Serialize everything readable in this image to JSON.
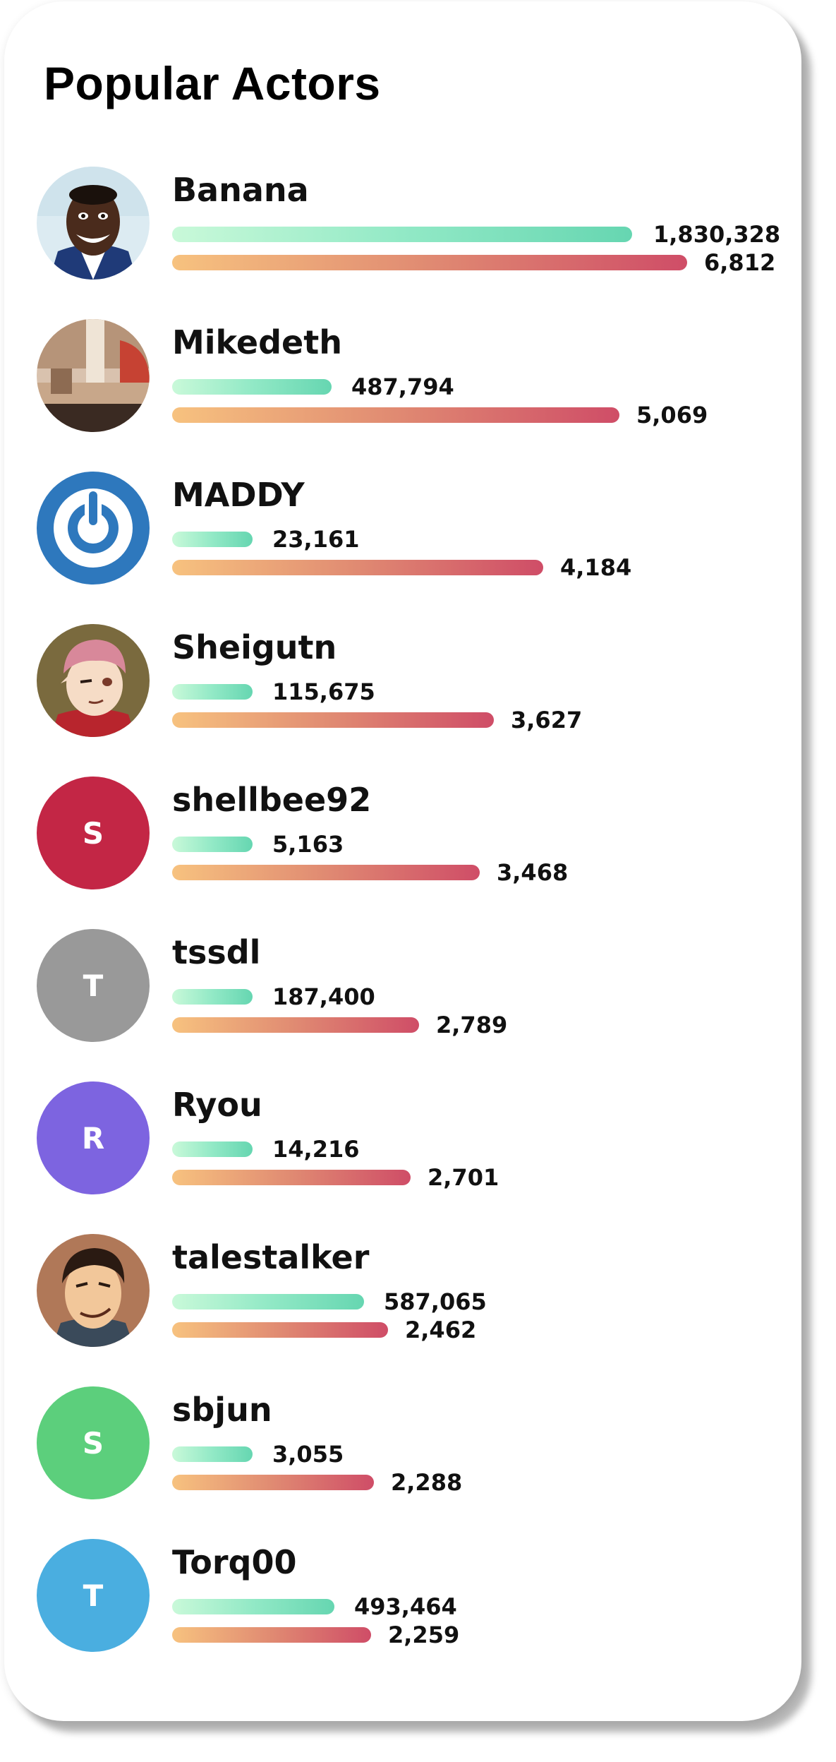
{
  "title": "Popular Actors",
  "colors": {
    "green_bar_start": "#c9f9d9",
    "green_bar_end": "#66d6b1",
    "red_bar_start": "#f7c27f",
    "red_bar_end": "#cf4d67"
  },
  "actors": [
    {
      "name": "Banana",
      "primary_value": "1,830,328",
      "secondary_value": "6,812",
      "avatar": {
        "type": "photo",
        "icon": "smiling-man-photo"
      }
    },
    {
      "name": "Mikedeth",
      "primary_value": "487,794",
      "secondary_value": "5,069",
      "avatar": {
        "type": "photo",
        "icon": "interior-photo"
      }
    },
    {
      "name": "MADDY",
      "primary_value": "23,161",
      "secondary_value": "4,184",
      "avatar": {
        "type": "logo",
        "icon": "power-ring-logo",
        "color": "#2e78bd"
      }
    },
    {
      "name": "Sheigutn",
      "primary_value": "115,675",
      "secondary_value": "3,627",
      "avatar": {
        "type": "illustration",
        "icon": "anime-character-pink-hair"
      }
    },
    {
      "name": "shellbee92",
      "primary_value": "5,163",
      "secondary_value": "3,468",
      "avatar": {
        "type": "initial",
        "initial": "S",
        "color": "#c32645"
      }
    },
    {
      "name": "tssdl",
      "primary_value": "187,400",
      "secondary_value": "2,789",
      "avatar": {
        "type": "initial",
        "initial": "T",
        "color": "#999999"
      }
    },
    {
      "name": "Ryou",
      "primary_value": "14,216",
      "secondary_value": "2,701",
      "avatar": {
        "type": "initial",
        "initial": "R",
        "color": "#7d64e0"
      }
    },
    {
      "name": "talestalker",
      "primary_value": "587,065",
      "secondary_value": "2,462",
      "avatar": {
        "type": "illustration",
        "icon": "cartoon-man-smirk"
      }
    },
    {
      "name": "sbjun",
      "primary_value": "3,055",
      "secondary_value": "2,288",
      "avatar": {
        "type": "initial",
        "initial": "S",
        "color": "#5ccf7c"
      }
    },
    {
      "name": "Torq00",
      "primary_value": "493,464",
      "secondary_value": "2,259",
      "avatar": {
        "type": "initial",
        "initial": "T",
        "color": "#4aaee0"
      }
    }
  ]
}
